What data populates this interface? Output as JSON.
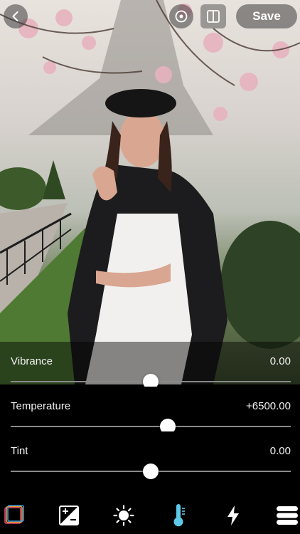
{
  "header": {
    "back_icon": "chevron-left-icon",
    "compare_icon": "compare-icon",
    "split_icon": "split-view-icon",
    "save_label": "Save"
  },
  "adjustments": [
    {
      "label": "Vibrance",
      "value": "0.00",
      "level": 0.5
    },
    {
      "label": "Temperature",
      "value": "+6500.00",
      "level": 0.56
    },
    {
      "label": "Tint",
      "value": "0.00",
      "level": 0.5
    }
  ],
  "toolbar": {
    "tools": [
      {
        "icon": "filters-icon",
        "active": false
      },
      {
        "icon": "exposure-icon",
        "active": false
      },
      {
        "icon": "brightness-icon",
        "active": false
      },
      {
        "icon": "temperature-icon",
        "active": true
      },
      {
        "icon": "sharpen-icon",
        "active": false
      },
      {
        "icon": "menu-icon",
        "active": false
      }
    ],
    "accent_color": "#5ec8e8"
  }
}
